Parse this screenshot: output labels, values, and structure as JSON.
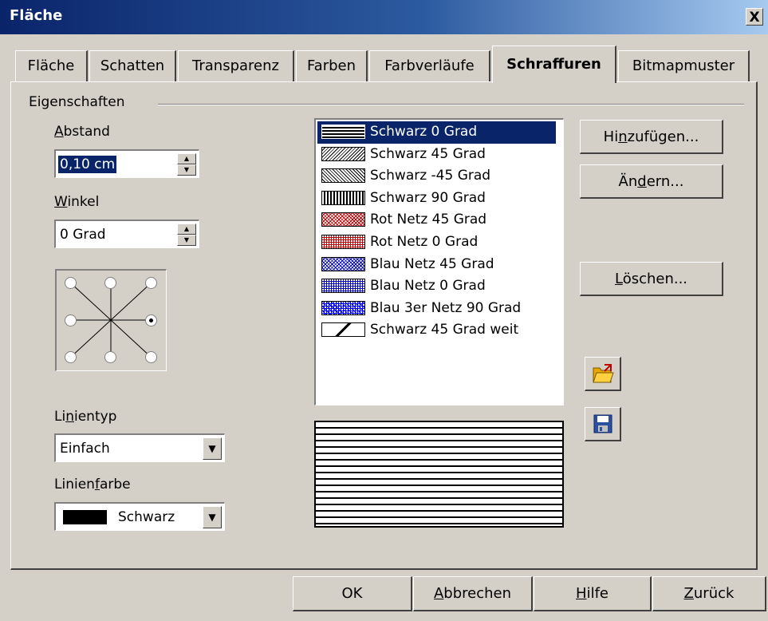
{
  "window": {
    "title": "Fläche",
    "close_glyph": "X"
  },
  "tabs": [
    {
      "label": "Fläche"
    },
    {
      "label": "Schatten"
    },
    {
      "label": "Transparenz"
    },
    {
      "label": "Farben"
    },
    {
      "label": "Farbverläufe"
    },
    {
      "label": "Schraffuren",
      "active": true
    },
    {
      "label": "Bitmapmuster"
    }
  ],
  "properties": {
    "group_label": "Eigenschaften",
    "abstand_label_u": "A",
    "abstand_label_rest": "bstand",
    "abstand_value": "0,10 cm",
    "winkel_label_u": "W",
    "winkel_label_rest": "inkel",
    "winkel_value": "0 Grad",
    "angle_selected": "right",
    "linientyp_label_a": "Li",
    "linientyp_label_u": "n",
    "linientyp_label_b": "ientyp",
    "linientyp_value": "Einfach",
    "linienfarbe_label_a": "Linien",
    "linienfarbe_label_u": "f",
    "linienfarbe_label_b": "arbe",
    "linienfarbe_value": "Schwarz",
    "linienfarbe_color": "#000000"
  },
  "hatch_list": [
    {
      "label": "Schwarz 0 Grad",
      "color": "#000000",
      "pattern": "h"
    },
    {
      "label": "Schwarz 45 Grad",
      "color": "#000000",
      "pattern": "d45"
    },
    {
      "label": "Schwarz -45 Grad",
      "color": "#000000",
      "pattern": "dm45"
    },
    {
      "label": "Schwarz 90 Grad",
      "color": "#000000",
      "pattern": "v"
    },
    {
      "label": "Rot Netz 45 Grad",
      "color": "#c00000",
      "pattern": "x45"
    },
    {
      "label": "Rot Netz 0 Grad",
      "color": "#c00000",
      "pattern": "grid"
    },
    {
      "label": "Blau Netz 45 Grad",
      "color": "#0000c0",
      "pattern": "x45"
    },
    {
      "label": "Blau Netz 0 Grad",
      "color": "#0000c0",
      "pattern": "grid"
    },
    {
      "label": "Blau 3er Netz 90 Grad",
      "color": "#0000ff",
      "pattern": "grid3"
    },
    {
      "label": "Schwarz 45 Grad weit",
      "color": "#000000",
      "pattern": "wide"
    }
  ],
  "selected_index": 0,
  "side_buttons": {
    "add_a": "Hi",
    "add_u": "n",
    "add_b": "zufügen...",
    "modify_a": "Än",
    "modify_u": "d",
    "modify_b": "ern...",
    "delete_u": "L",
    "delete_b": "öschen..."
  },
  "icons": {
    "load": "folder-open-icon",
    "save": "floppy-disk-icon"
  },
  "footer": {
    "ok": "OK",
    "cancel_u": "A",
    "cancel_b": "bbrechen",
    "help_u": "H",
    "help_b": "ilfe",
    "back_u": "Z",
    "back_b": "urück"
  }
}
